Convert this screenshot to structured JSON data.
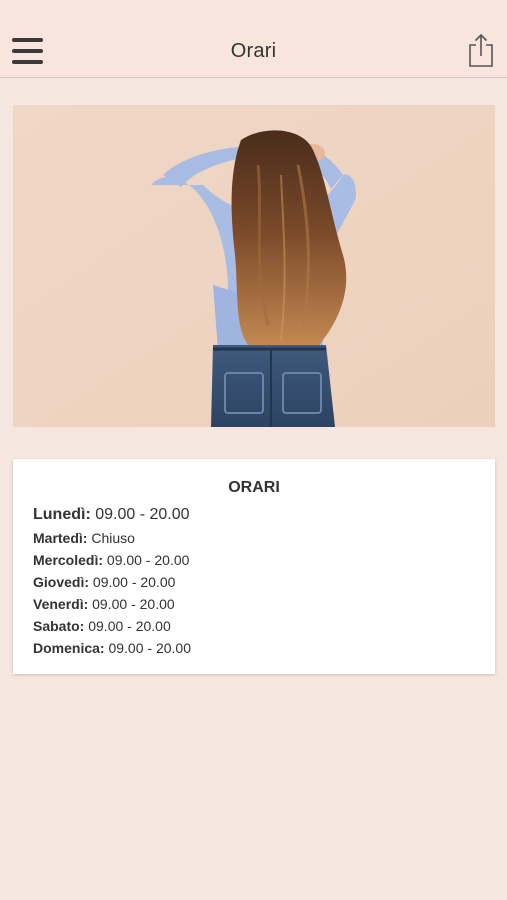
{
  "header": {
    "title": "Orari",
    "menu_icon": "hamburger-menu-icon",
    "share_icon": "share-icon"
  },
  "hero": {
    "icon": "photo-woman-long-wavy-hair"
  },
  "hours_card": {
    "title": "ORARI",
    "rows": [
      {
        "day": "Lunedì:",
        "hours": "09.00 - 20.00"
      },
      {
        "day": "Martedì:",
        "hours": "Chiuso"
      },
      {
        "day": "Mercoledì:",
        "hours": "09.00 - 20.00"
      },
      {
        "day": "Giovedì:",
        "hours": "09.00 - 20.00"
      },
      {
        "day": "Venerdì:",
        "hours": "09.00 - 20.00"
      },
      {
        "day": "Sabato:",
        "hours": "09.00 - 20.00"
      },
      {
        "day": "Domenica:",
        "hours": "09.00 - 20.00"
      }
    ]
  },
  "colors": {
    "background": "#f5e6df",
    "header": "#f8e6de",
    "card": "#ffffff",
    "text": "#333333"
  }
}
